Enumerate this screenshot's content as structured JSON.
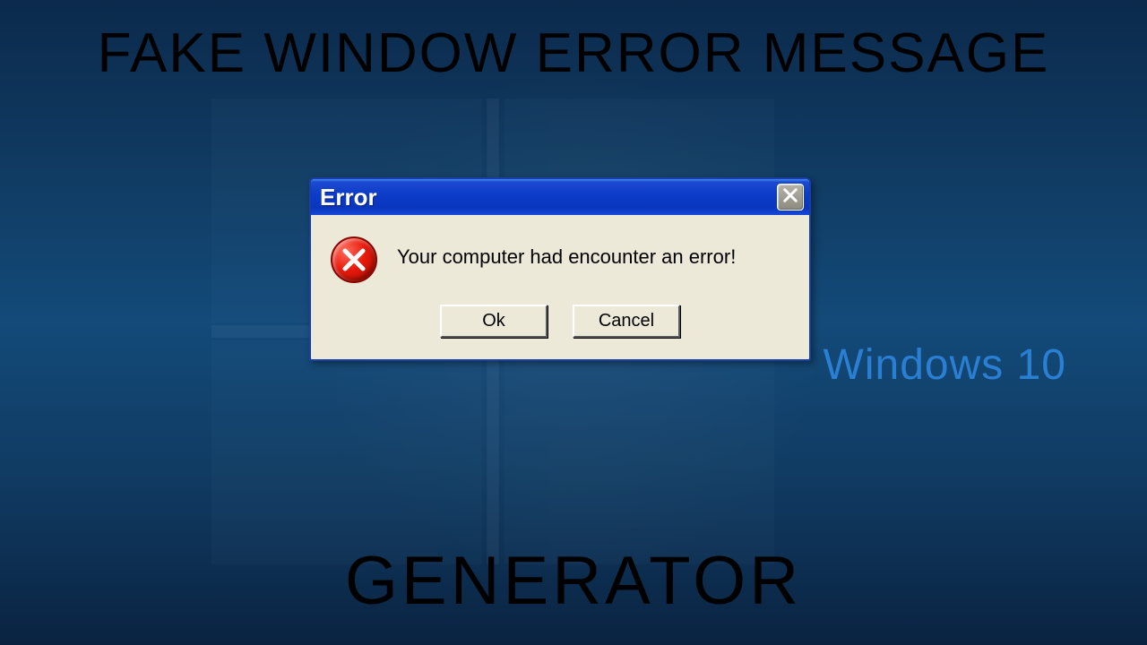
{
  "headline": "FAKE WINDOW ERROR MESSAGE",
  "footline": "GENERATOR",
  "brand_label": "Windows 10",
  "dialog": {
    "title": "Error",
    "message": "Your computer had encounter an error!",
    "ok_label": "Ok",
    "cancel_label": "Cancel"
  },
  "colors": {
    "titlebar_blue": "#0b3bc8",
    "dialog_bg": "#ece9d8",
    "error_red": "#e81a0c",
    "brand_blue": "#2a7fd3"
  }
}
